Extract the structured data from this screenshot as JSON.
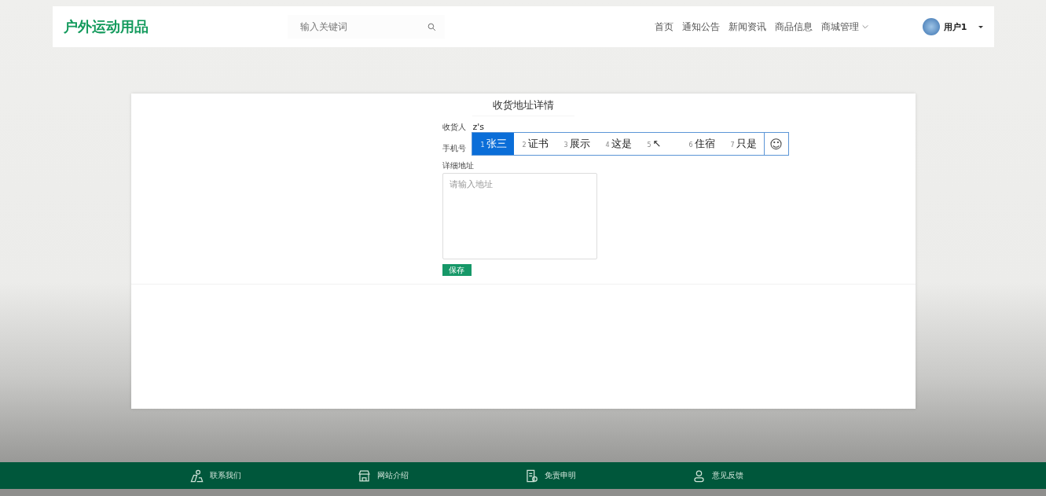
{
  "header": {
    "logo": "户外运动用品",
    "search": {
      "placeholder": "输入关键词"
    },
    "nav": [
      {
        "label": "首页",
        "dropdown": false
      },
      {
        "label": "通知公告",
        "dropdown": false
      },
      {
        "label": "新闻资讯",
        "dropdown": false
      },
      {
        "label": "商品信息",
        "dropdown": false
      },
      {
        "label": "商城管理",
        "dropdown": true
      }
    ],
    "user": {
      "name": "用户1"
    }
  },
  "page": {
    "title": "收货地址详情",
    "fields": [
      {
        "kind": "text",
        "label": "收货人",
        "value": "z's"
      },
      {
        "kind": "text",
        "label": "手机号"
      },
      {
        "kind": "textarea",
        "label": "详细地址",
        "placeholder": "请输入地址"
      }
    ],
    "save_button": "保存"
  },
  "ime": {
    "candidates": [
      {
        "index": "1",
        "text": "张三",
        "selected": true
      },
      {
        "index": "2",
        "text": "证书",
        "selected": false
      },
      {
        "index": "3",
        "text": "展示",
        "selected": false
      },
      {
        "index": "4",
        "text": "这是",
        "selected": false
      },
      {
        "index": "5",
        "text": "↖",
        "selected": false
      },
      {
        "index": "6",
        "text": "住宿",
        "selected": false
      },
      {
        "index": "7",
        "text": "只是",
        "selected": false
      }
    ],
    "emoji": "☺"
  },
  "footer": {
    "links": [
      {
        "label": "联系我们",
        "kind": "contact"
      },
      {
        "label": "网站介绍",
        "kind": "store"
      },
      {
        "label": "免责申明",
        "kind": "document"
      },
      {
        "label": "意见反馈",
        "kind": "person"
      }
    ]
  }
}
